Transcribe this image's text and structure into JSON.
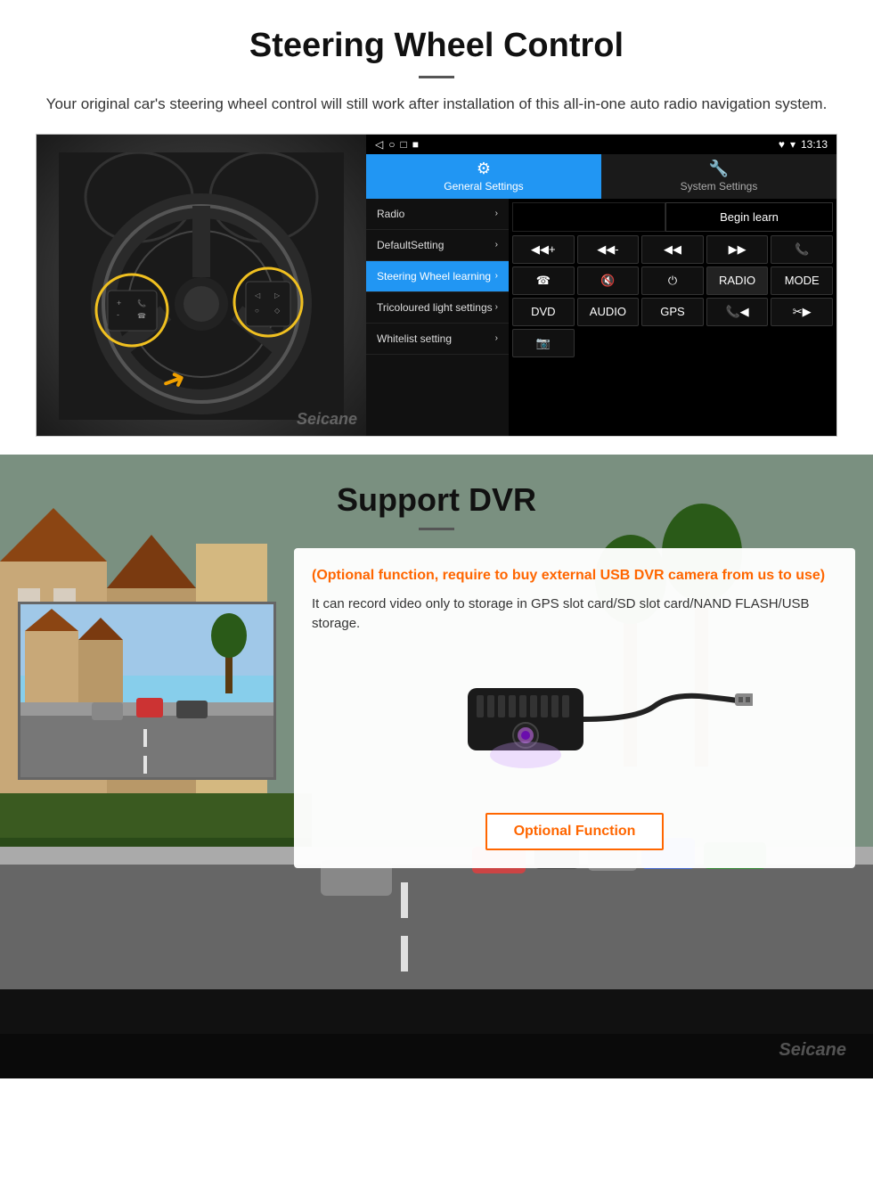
{
  "section1": {
    "title": "Steering Wheel Control",
    "description": "Your original car's steering wheel control will still work after installation of this all-in-one auto radio navigation system.",
    "watermark": "Seicane"
  },
  "android_ui": {
    "statusbar": {
      "signal": "▾",
      "wifi": "▾",
      "time": "13:13"
    },
    "navbar": {
      "back": "◁",
      "home": "○",
      "recent": "□",
      "app": "■"
    },
    "tab_general": "General Settings",
    "tab_system": "System Settings",
    "tab_general_icon": "⚙",
    "tab_system_icon": "☆",
    "menu_items": [
      {
        "label": "Radio",
        "active": false
      },
      {
        "label": "DefaultSetting",
        "active": false
      },
      {
        "label": "Steering Wheel learning",
        "active": true
      },
      {
        "label": "Tricoloured light settings",
        "active": false
      },
      {
        "label": "Whitelist setting",
        "active": false
      }
    ],
    "begin_learn": "Begin learn",
    "control_buttons": [
      "◀◀+",
      "◀◀-",
      "◀◀",
      "▶▶",
      "📞",
      "☎",
      "🔇x",
      "⏻",
      "RADIO",
      "MODE",
      "DVD",
      "AUDIO",
      "GPS",
      "📞◀",
      "✂▶"
    ]
  },
  "section2": {
    "title": "Support DVR",
    "optional_text": "(Optional function, require to buy external USB DVR camera from us to use)",
    "description": "It can record video only to storage in GPS slot card/SD slot card/NAND FLASH/USB storage.",
    "optional_function_label": "Optional Function",
    "watermark": "Seicane"
  }
}
